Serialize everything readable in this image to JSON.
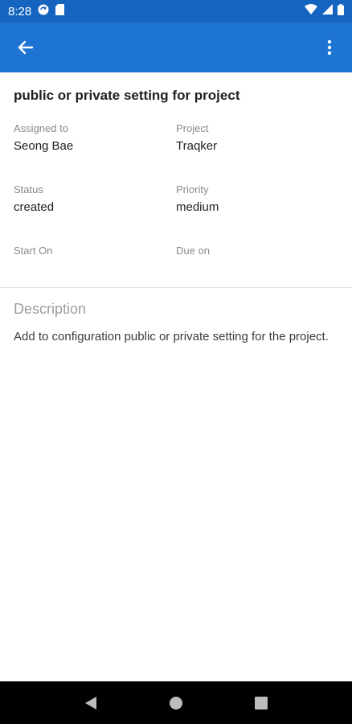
{
  "status_bar": {
    "time": "8:28",
    "icons": [
      "sync-icon",
      "sd-card-icon",
      "wifi-icon",
      "cell-signal-icon",
      "battery-icon"
    ]
  },
  "app_bar": {
    "back_icon": "arrow-back-icon",
    "menu_icon": "more-vert-icon",
    "color": "#1e74d3"
  },
  "task": {
    "title": "public or private setting for project",
    "fields": {
      "assigned_to": {
        "label": "Assigned to",
        "value": "Seong Bae"
      },
      "project": {
        "label": "Project",
        "value": "Traqker"
      },
      "status": {
        "label": "Status",
        "value": "created"
      },
      "priority": {
        "label": "Priority",
        "value": "medium"
      },
      "start_on": {
        "label": "Start On",
        "value": ""
      },
      "due_on": {
        "label": "Due on",
        "value": ""
      }
    },
    "description_heading": "Description",
    "description": "Add to configuration public or private setting for the project."
  },
  "nav_bar": {
    "icons": [
      "nav-back-icon",
      "nav-home-icon",
      "nav-recents-icon"
    ]
  }
}
